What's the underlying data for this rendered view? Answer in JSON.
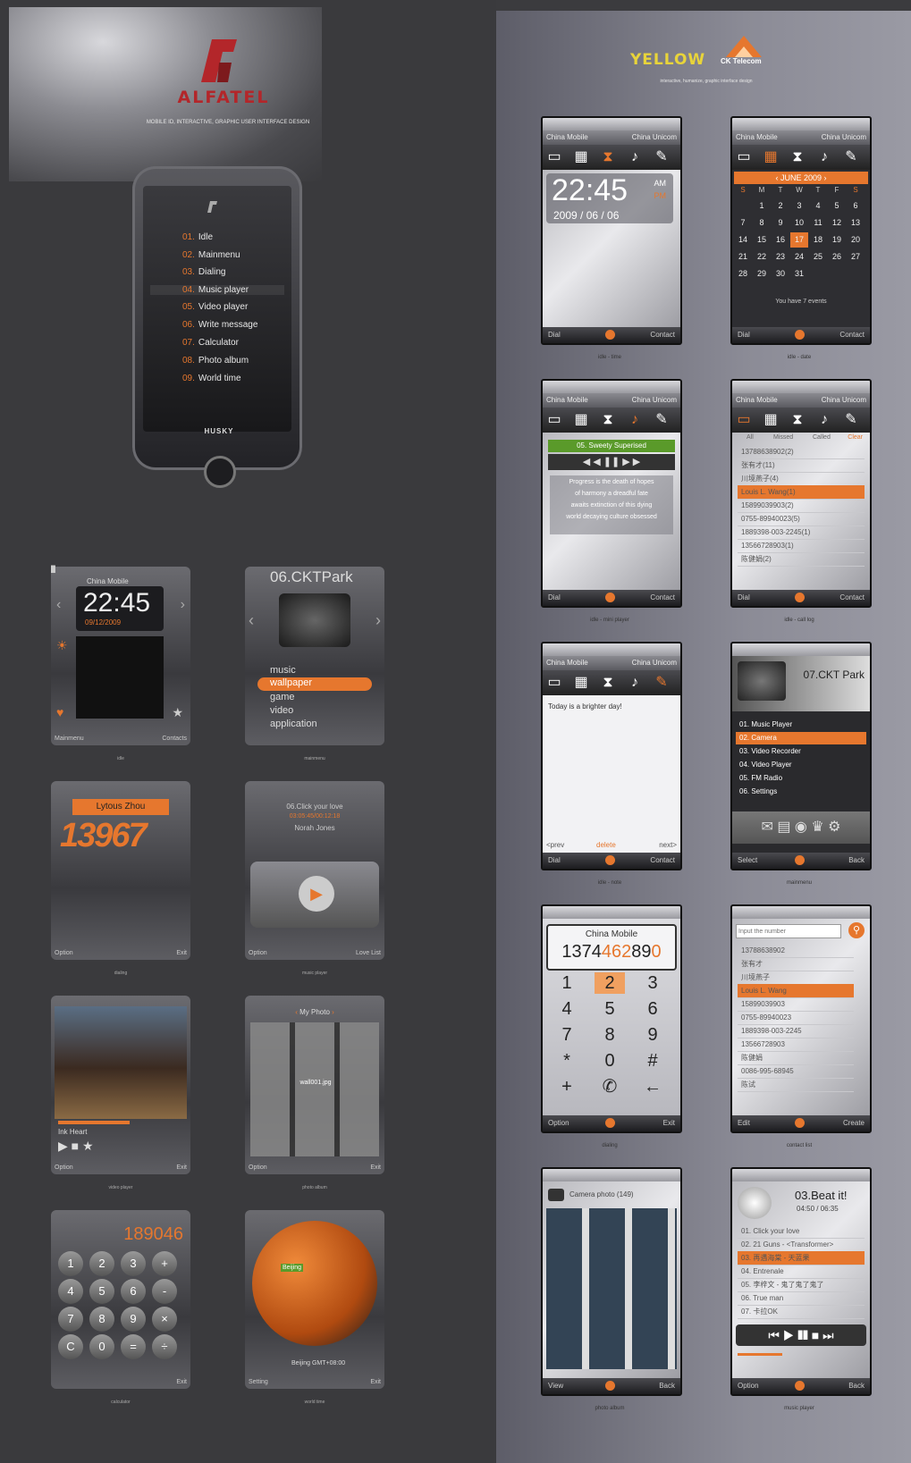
{
  "brand": {
    "logo_text": "ALFATEL",
    "subtitle": "MOBILE ID, INTERACTIVE, GRAPHIC USER INTERFACE DESIGN",
    "phone_brand": "HUSKY"
  },
  "main_menu": [
    {
      "num": "01.",
      "label": "Idle"
    },
    {
      "num": "02.",
      "label": "Mainmenu"
    },
    {
      "num": "03.",
      "label": "Dialing"
    },
    {
      "num": "04.",
      "label": "Music player"
    },
    {
      "num": "05.",
      "label": "Video player"
    },
    {
      "num": "06.",
      "label": "Write message"
    },
    {
      "num": "07.",
      "label": "Calculator"
    },
    {
      "num": "08.",
      "label": "Photo album"
    },
    {
      "num": "09.",
      "label": "World time"
    }
  ],
  "left_screens": {
    "idle": {
      "carrier": "China Mobile",
      "time": "22:45",
      "date": "09/12/2009",
      "soft_left": "Mainmenu",
      "soft_right": "Contacts",
      "caption": "idle"
    },
    "mainmenu": {
      "title": "06.CKTPark",
      "items": [
        "music",
        "wallpaper",
        "game",
        "video",
        "application"
      ],
      "caption": "mainmenu"
    },
    "dialing": {
      "name": "Lytous Zhou",
      "number": "13967",
      "soft_left": "Option",
      "soft_right": "Exit",
      "caption": "dialing"
    },
    "music": {
      "song": "06.Click your love",
      "time": "03:05:45/00:12:18",
      "artist": "Norah Jones",
      "soft_left": "Option",
      "soft_right": "Love List",
      "caption": "music player"
    },
    "video": {
      "title": "Ink Heart",
      "soft_left": "Option",
      "soft_right": "Exit",
      "caption": "video player"
    },
    "photo": {
      "title": "My Photo",
      "file": "wall001.jpg",
      "soft_left": "Option",
      "soft_right": "Exit",
      "caption": "photo album"
    },
    "calculator": {
      "display": "189046",
      "keys": [
        "1",
        "2",
        "3",
        "+",
        "4",
        "5",
        "6",
        "-",
        "7",
        "8",
        "9",
        "×",
        "C",
        "0",
        "=",
        "÷"
      ],
      "soft_right": "Exit",
      "caption": "calculator"
    },
    "world": {
      "city": "Beijing",
      "label": "Beijing GMT+08:00",
      "soft_left": "Setting",
      "soft_right": "Exit",
      "caption": "world time"
    }
  },
  "right_brand": {
    "yellow": "YELLOW",
    "ckt": "CK Telecom",
    "subtitle": "interactive, humanize, graphic interface design"
  },
  "carriers": {
    "a": "China Mobile",
    "b": "China Unicom"
  },
  "soft": {
    "dial": "Dial",
    "contact": "Contact"
  },
  "right_screens": {
    "idle_time": {
      "time": "22:45",
      "ampm_top": "AM",
      "ampm_bot": "PM",
      "date": "2009 / 06 / 06",
      "caption": "idle - time"
    },
    "idle_date": {
      "month": "JUNE 2009",
      "weekdays": [
        "S",
        "M",
        "T",
        "W",
        "T",
        "F",
        "S"
      ],
      "days": [
        "",
        "1",
        "2",
        "3",
        "4",
        "5",
        "6",
        "7",
        "8",
        "9",
        "10",
        "11",
        "12",
        "13",
        "14",
        "15",
        "16",
        "17",
        "18",
        "19",
        "20",
        "21",
        "22",
        "23",
        "24",
        "25",
        "26",
        "27",
        "28",
        "29",
        "30",
        "31",
        "",
        "",
        ""
      ],
      "events": "You have 7 events",
      "caption": "idle - date"
    },
    "idle_player": {
      "song": "05. Sweety Superised",
      "lyrics": [
        "Progress is the death of hopes",
        "of harmony a dreadful fate",
        "awaits extinction of this dying",
        "world decaying culture obsessed"
      ],
      "caption": "idle - mini player"
    },
    "idle_calllog": {
      "tabs": [
        "All",
        "Missed",
        "Called",
        "Clear"
      ],
      "rows": [
        "13788638902(2)",
        "张有才(11)",
        "川境燕子(4)",
        "Louis L. Wang(1)",
        "15899039903(2)",
        "0755-89940023(5)",
        "1889398-003-2245(1)",
        "13566728903(1)",
        "陈健娟(2)"
      ],
      "caption": "idle - call log"
    },
    "idle_note": {
      "text": "Today is a brighter day!",
      "prev": "<prev",
      "del": "delete",
      "next": "next>",
      "caption": "idle - note"
    },
    "mainmenu": {
      "title": "07.CKT Park",
      "items": [
        "01. Music Player",
        "02. Camera",
        "03. Video Recorder",
        "04. Video Player",
        "05. FM Radio",
        "06. Settings"
      ],
      "soft_left": "Select",
      "soft_right": "Back",
      "caption": "mainmenu"
    },
    "dialing": {
      "carrier": "China Mobile",
      "number_a": "1374",
      "number_b": "462",
      "number_c": "89",
      "number_d": "0",
      "keys": [
        "1",
        "2",
        "3",
        "4",
        "5",
        "6",
        "7",
        "8",
        "9",
        "*",
        "0",
        "#",
        "+",
        "✆",
        "←"
      ],
      "soft_left": "Option",
      "soft_right": "Exit",
      "caption": "dialing"
    },
    "contacts": {
      "placeholder": "Input the number",
      "rows": [
        "13788638902",
        "张有才",
        "川境燕子",
        "Louis L. Wang",
        "15899039903",
        "0755-89940023",
        "1889398-003-2245",
        "13566728903",
        "陈健娟",
        "0086-995-68945",
        "陈试"
      ],
      "soft_left": "Edit",
      "soft_right": "Create",
      "caption": "contact list"
    },
    "photo": {
      "title": "Camera photo (149)",
      "soft_left": "View",
      "soft_right": "Back",
      "caption": "photo album"
    },
    "music": {
      "title": "03.Beat it!",
      "time": "04:50 / 06:35",
      "tracks": [
        "01. Click your love",
        "02. 21 Guns - <Transformer>",
        "03. 再遇海棠 - 天蓝果",
        "04. Entrenale",
        "05. 李梓文 - 鬼了鬼了鬼了",
        "06. True man",
        "07. 卡拉OK"
      ],
      "soft_left": "Option",
      "soft_right": "Back",
      "caption": "music player"
    }
  },
  "colors": {
    "accent": "#e6772e",
    "brand_red": "#b3262a",
    "yellow": "#e8d43a"
  }
}
